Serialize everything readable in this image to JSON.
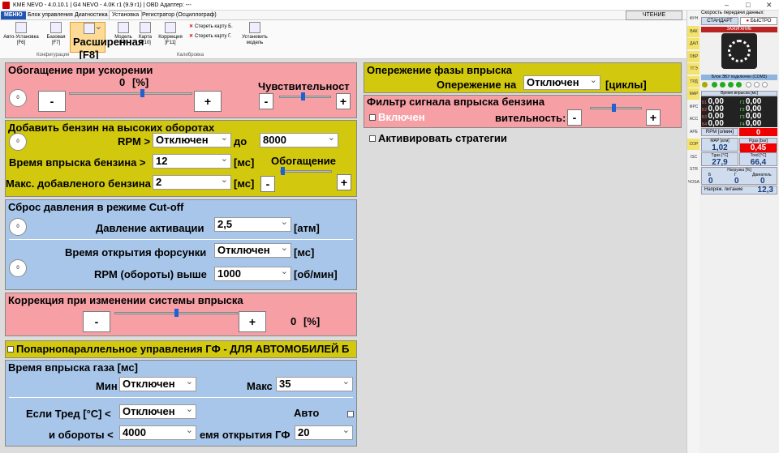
{
  "titlebar": {
    "text": "KME NEVO - 4.0.10.1  |  G4 NEVO - 4.0K r1 (9.9 r1)  |  OBD Адаптер: ---"
  },
  "menubar": {
    "file": "МЕНЮ",
    "items": [
      "Блок управления",
      "Диагностика",
      "Установка",
      "Регистратор (Осциллограф)"
    ],
    "read": "ЧТЕНИЕ"
  },
  "ribbon": {
    "buttons": [
      {
        "l1": "Авто-Установка",
        "l2": "[F6]"
      },
      {
        "l1": "Базовая",
        "l2": "[F7]"
      },
      {
        "l1": "Расширенная",
        "l2": "[F8]"
      },
      {
        "l1": "Модель",
        "l2": "[F9]"
      },
      {
        "l1": "Карта",
        "l2": "[F10]"
      },
      {
        "l1": "Коррекция",
        "l2": "[F11]"
      }
    ],
    "erase_b": "Стереть карту Б.",
    "erase_g": "Стереть карту Г.",
    "install_model_1": "Установить",
    "install_model_2": "модель",
    "group_config": "Конфигурация",
    "group_calib": "Калибровка"
  },
  "panels": {
    "accel": {
      "title": "Обогащение при ускорении",
      "value": "0",
      "unit": "[%]",
      "sensitivity": "Чувствительност",
      "slider": 0.6,
      "sens_slider": 0.45
    },
    "highrpm": {
      "title": "Добавить бензин на высоких оборотах",
      "rpm_label": "RPM >",
      "rpm_sel": "Отключен",
      "to": "до",
      "to_val": "8000",
      "inj_label": "Время впрыска бензина >",
      "inj_val": "12",
      "inj_unit": "[мс]",
      "max_label": "Макс. добавленого бензина",
      "max_val": "2",
      "max_unit": "[мс]",
      "enrich": "Обогащение",
      "slider": 0.0
    },
    "cutoff": {
      "title": "Сброс давления в режиме Cut-off",
      "act_label": "Давление активации",
      "act_val": "2,5",
      "act_unit": "[атм]",
      "open_label": "Время открытия форсунки",
      "open_val": "Отключен",
      "open_unit": "[мс]",
      "rpm_label": "RPM (обороты) выше",
      "rpm_val": "1000",
      "rpm_unit": "[об/мин]"
    },
    "corr": {
      "title": "Коррекция при изменении системы впрыска",
      "value": "0",
      "unit": "[%]",
      "slider": 0.5
    },
    "parallel": {
      "title": "Попарнопараллельное управления ГФ - ДЛЯ АВТОМОБИЛЕЙ Б"
    },
    "gastime": {
      "title": "Время впрыска газа [мс]",
      "min_label": "Мин",
      "min_val": "Отключен",
      "max_label": "Макс",
      "max_val": "35",
      "temp_label": "Если Тред [°C] <",
      "temp_val": "Отключен",
      "auto": "Авто",
      "rpm_label": "и обороты <",
      "rpm_val": "4000",
      "open_label": "емя открытия ГФ",
      "open_val": "20"
    },
    "phase": {
      "title": "Опережение фазы впрыска",
      "label": "Опережение на",
      "val": "Отключен",
      "unit": "[циклы]"
    },
    "filter": {
      "title": "Фильтр сигнала впрыска бензина",
      "enabled": "Включен",
      "sens": "вительность:",
      "slider": 0.45
    },
    "strategies": {
      "label": "Активировать стратегии"
    }
  },
  "vtabs": [
    "ФУН",
    "ВАК",
    "ДАЛ",
    "ОБР",
    "ТГЭ",
    "ТРД",
    "МАР",
    "ФРС",
    "АСС",
    "АРЕ",
    "СОР",
    "ISC",
    "STR",
    "ЧОSA"
  ],
  "side": {
    "speed_title": "Скорость передачи данных:",
    "standard": "СТАНДАРТ",
    "fast": "БЫСТРО",
    "ignition": "ЗАЖИГАНИЕ",
    "ecu": "Блок ЭБУ подключен (СОМ3)",
    "inj_title": "Время впрыска [мс]",
    "b": [
      "0,00",
      "0,00",
      "0,00",
      "0,00"
    ],
    "g": [
      "0,00",
      "0,00",
      "0,00",
      "0,00"
    ],
    "rpm_label": "RPM [о/мин]",
    "rpm_val": "0",
    "map_label": "MAP [атм]",
    "map_val": "1,02",
    "pgas_label": "Pgas [bar]",
    "pgas_val": "0,45",
    "tgas_label": "Tgas [°C]",
    "tgas_val": "27,9",
    "tred_label": "Tred [°C]",
    "tred_val": "66,4",
    "load_title": "Нагрузка [%]",
    "load_b": "Б",
    "load_g": "Г",
    "load_eng": "Двигатель",
    "load_vals": [
      "0",
      "0",
      "0"
    ],
    "volt_label": "Напряж. питание",
    "volt_val": "12,3"
  }
}
